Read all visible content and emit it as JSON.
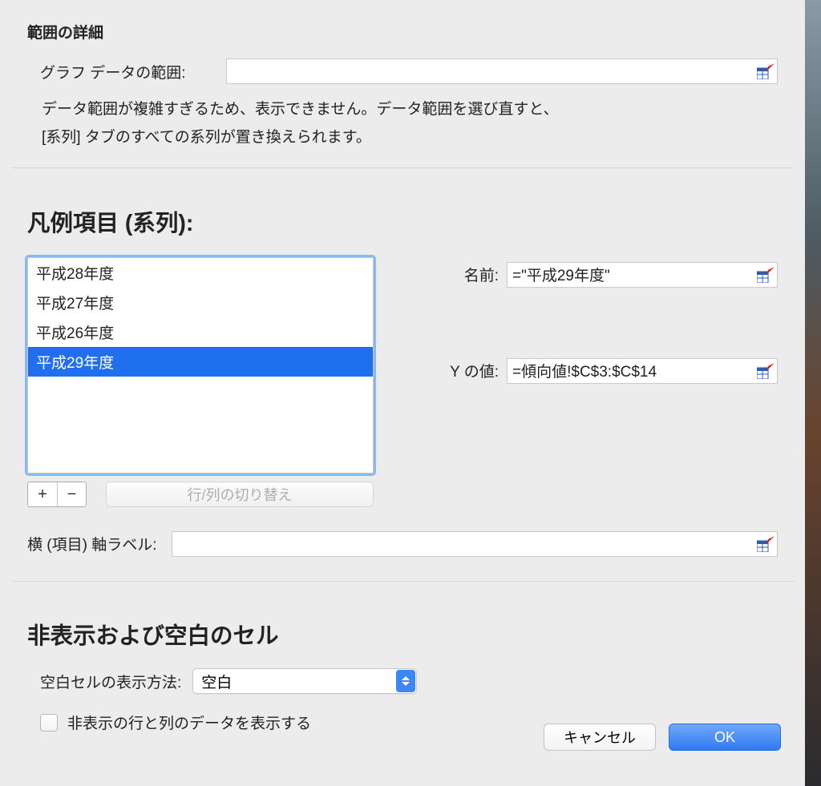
{
  "range_section": {
    "title": "範囲の詳細",
    "data_range_label": "グラフ データの範囲:",
    "data_range_value": "",
    "note_line1": "データ範囲が複雑すぎるため、表示できません。データ範囲を選び直すと、",
    "note_line2": "[系列] タブのすべての系列が置き換えられます。"
  },
  "legend_section": {
    "title": "凡例項目 (系列):",
    "items": [
      {
        "label": "平成28年度",
        "selected": false
      },
      {
        "label": "平成27年度",
        "selected": false
      },
      {
        "label": "平成26年度",
        "selected": false
      },
      {
        "label": "平成29年度",
        "selected": true
      }
    ],
    "add_label": "+",
    "remove_label": "−",
    "switch_label": "行/列の切り替え",
    "name_label": "名前:",
    "name_value": "=\"平成29年度\"",
    "yvalue_label": "Y の値:",
    "yvalue_value": "=傾向値!$C$3:$C$14"
  },
  "axis": {
    "label": "横 (項目) 軸ラベル:",
    "value": ""
  },
  "hidden_section": {
    "title": "非表示および空白のセル",
    "blank_label": "空白セルの表示方法:",
    "blank_value": "空白",
    "show_hidden_label": "非表示の行と列のデータを表示する"
  },
  "buttons": {
    "cancel": "キャンセル",
    "ok": "OK"
  }
}
